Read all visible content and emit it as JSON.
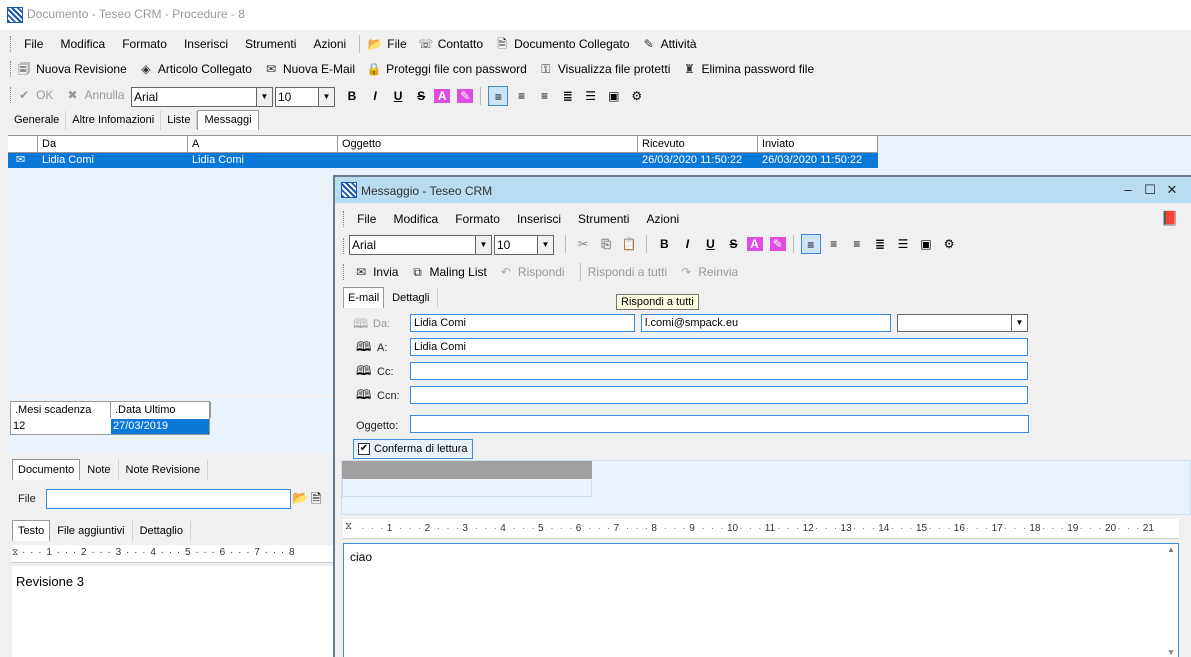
{
  "main_window": {
    "title": "Documento - Teseo CRM - Procedure - 8",
    "menu": [
      "File",
      "Modifica",
      "Formato",
      "Inserisci",
      "Strumenti",
      "Azioni"
    ],
    "menu_links": [
      "File",
      "Contatto",
      "Documento Collegato",
      "Attività"
    ],
    "toolbar2": [
      "Nuova Revisione",
      "Articolo Collegato",
      "Nuova E-Mail",
      "Proteggi file con password",
      "Visualizza file protetti",
      "Elimina password file"
    ],
    "ok_label": "OK",
    "annulla_label": "Annulla",
    "font_name": "Arial",
    "font_size": "10",
    "tabs": [
      "Generale",
      "Altre Infomazioni",
      "Liste",
      "Messaggi"
    ],
    "active_tab": "Messaggi",
    "grid": {
      "columns": [
        "Da",
        "A",
        "Oggetto",
        "Ricevuto",
        "Inviato"
      ],
      "rows": [
        {
          "da": "Lidia Comi",
          "a": "Lidia Comi",
          "oggetto": "",
          "ricevuto": "26/03/2020 11:50:22",
          "inviato": "26/03/2020 11:50:22"
        }
      ]
    },
    "small_grid": {
      "columns": [
        ".Mesi scadenza",
        ".Data Ultimo Rinnovo"
      ],
      "row": [
        "12",
        "27/03/2019"
      ]
    },
    "bottom_tabs": [
      "Documento",
      "Note",
      "Note Revisione"
    ],
    "file_label": "File",
    "file_value": "",
    "text_tabs": [
      "Testo",
      "File aggiuntivi",
      "Dettaglio"
    ],
    "body_text": "Revisione 3"
  },
  "message_window": {
    "title": "Messaggio - Teseo CRM",
    "menu": [
      "File",
      "Modifica",
      "Formato",
      "Inserisci",
      "Strumenti",
      "Azioni"
    ],
    "font_name": "Arial",
    "font_size": "10",
    "actions": [
      "Invia",
      "Maling List",
      "Rispondi",
      "Rispondi a tutti",
      "Reinvia"
    ],
    "tabs": [
      "E-mail",
      "Dettagli"
    ],
    "tooltip": "Rispondi a tutti",
    "fields": {
      "da_label": "Da:",
      "da_name": "Lidia Comi",
      "da_email": "l.comi@smpack.eu",
      "da_extra": "",
      "a_label": "A:",
      "a_value": "Lidia Comi",
      "cc_label": "Cc:",
      "cc_value": "",
      "ccn_label": "Ccn:",
      "ccn_value": "",
      "oggetto_label": "Oggetto:",
      "oggetto_value": ""
    },
    "confirm_label": "Conferma di lettura",
    "confirm_checked": true,
    "body_text": "ciao",
    "ruler_numbers": [
      "1",
      "2",
      "3",
      "4",
      "5",
      "6",
      "7",
      "8",
      "9",
      "10",
      "11",
      "12",
      "13",
      "14",
      "15",
      "16",
      "17",
      "18",
      "19",
      "20",
      "21"
    ]
  }
}
